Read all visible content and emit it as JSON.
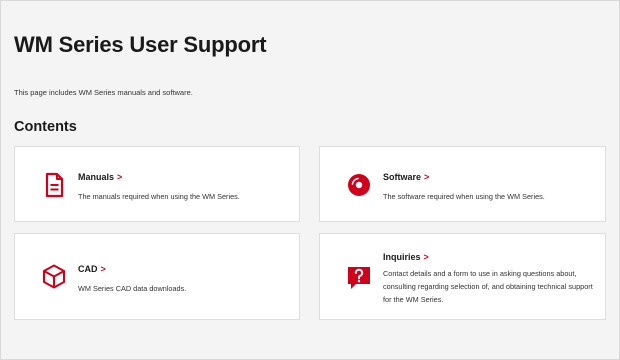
{
  "page": {
    "title": "WM Series User Support",
    "intro": "This page includes WM Series manuals and software.",
    "section_title": "Contents"
  },
  "cards": [
    {
      "title": "Manuals",
      "chevron": ">",
      "description": "The manuals required when using the WM Series.",
      "icon": "document-icon"
    },
    {
      "title": "Software",
      "chevron": ">",
      "description": "The software required when using the WM Series.",
      "icon": "disc-icon"
    },
    {
      "title": "CAD",
      "chevron": ">",
      "description": "WM Series CAD data downloads.",
      "icon": "cube-icon"
    },
    {
      "title": "Inquiries",
      "chevron": ">",
      "description": "Contact details and a form to use in asking questions about, consulting regarding selection of, and obtaining technical support for the WM Series.",
      "icon": "question-bubble-icon"
    }
  ],
  "colors": {
    "accent": "#d0021b",
    "background": "#f4f4f5",
    "card": "#ffffff"
  }
}
